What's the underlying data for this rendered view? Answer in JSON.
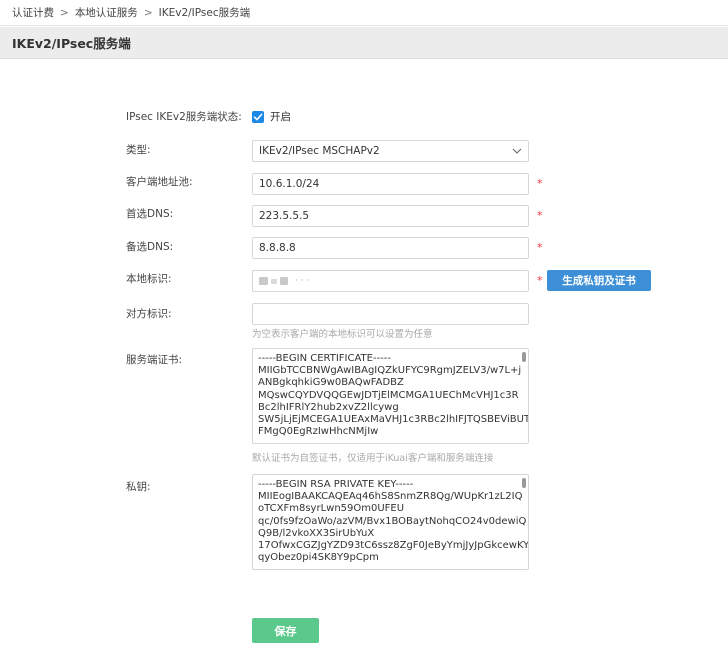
{
  "breadcrumb": {
    "items": [
      "认证计费",
      "本地认证服务",
      "IKEv2/IPsec服务端"
    ],
    "separator": ">"
  },
  "page": {
    "title": "IKEv2/IPsec服务端"
  },
  "form": {
    "status": {
      "label": "IPsec IKEv2服务端状态:",
      "checked": true,
      "check_label": "开启"
    },
    "type": {
      "label": "类型:",
      "value": "IKEv2/IPsec MSCHAPv2"
    },
    "pool": {
      "label": "客户端地址池:",
      "value": "10.6.1.0/24"
    },
    "dns1": {
      "label": "首选DNS:",
      "value": "223.5.5.5"
    },
    "dns2": {
      "label": "备选DNS:",
      "value": "8.8.8.8"
    },
    "local_id": {
      "label": "本地标识:",
      "value_tail": "· · ·",
      "gen_button": "生成私钥及证书"
    },
    "remote_id": {
      "label": "对方标识:",
      "value": "",
      "hint": "为空表示客户端的本地标识可以设置为任意"
    },
    "cert": {
      "label": "服务端证书:",
      "lines": [
        "-----BEGIN CERTIFICATE-----",
        "MIIGbTCCBNWgAwIBAgIQZkUFYC9RgmJZELV3/w7L+j",
        "ANBgkqhkiG9w0BAQwFADBZ",
        "MQswCQYDVQQGEwJDTjElMCMGA1UEChMcVHJ1c3R",
        "Bc2lhIFRlY2hub2xvZ2llcywg",
        "SW5jLjEjMCEGA1UEAxMaVHJ1c3RBc2lhIFJTQSBEViBUT",
        "FMgQ0EgRzIwHhcNMjIw"
      ],
      "hint": "默认证书为自签证书，仅适用于iKuai客户端和服务端连接"
    },
    "key": {
      "label": "私钥:",
      "lines": [
        "-----BEGIN RSA PRIVATE KEY-----",
        "MIIEogIBAAKCAQEAq46hS8SnmZR8Qg/WUpKr1zL2IQ",
        "oTCXFm8syrLwn59Om0UFEU",
        "qc/0fs9fzOaWo/azVM/Bvx1BOBaytNohqCO24v0dewiQ",
        "Q9B/l2vkoXX3SirUbYuX",
        "17OfwxCGZJgYZD93tC6ssz8ZgF0JeByYmjJyJpGkcewKY",
        "qyObez0pi4SK8Y9pCpm"
      ]
    },
    "required_mark": "*",
    "save_button": "保存"
  },
  "colors": {
    "accent": "#1e88e5",
    "gen_button": "#3d8fd8",
    "save_button": "#5cc98c",
    "required": "#e4393c"
  }
}
